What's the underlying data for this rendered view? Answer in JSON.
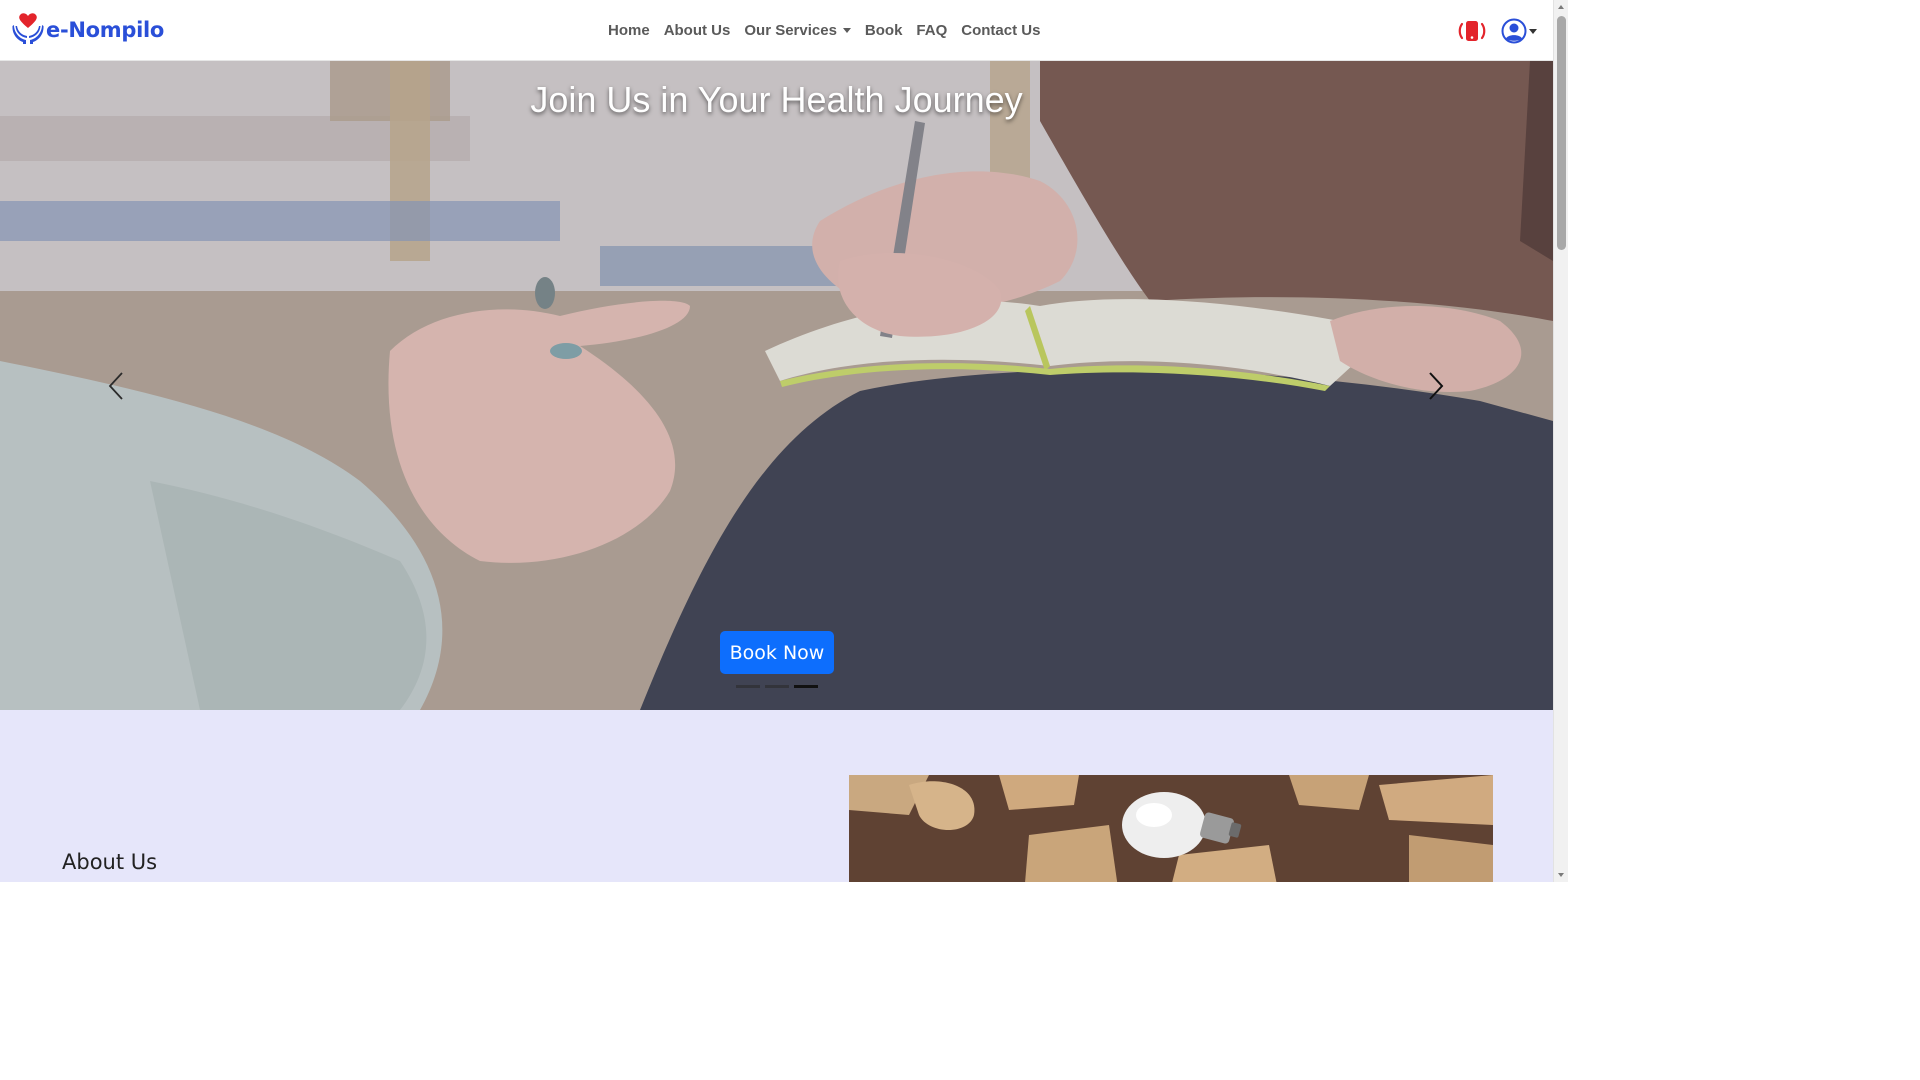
{
  "brand": {
    "name": "e-Nompilo",
    "logo_icon": "heart-hands-icon"
  },
  "nav": {
    "items": [
      {
        "label": "Home"
      },
      {
        "label": "About Us"
      },
      {
        "label": "Our Services",
        "dropdown": true
      },
      {
        "label": "Book"
      },
      {
        "label": "FAQ"
      },
      {
        "label": "Contact Us"
      }
    ]
  },
  "header_actions": {
    "emergency_icon": "emergency-phone-icon",
    "user_icon": "user-circle-icon"
  },
  "hero": {
    "title": "Join Us in Your Health Journey",
    "cta_label": "Book Now",
    "slide_count": 3,
    "active_slide": 3
  },
  "about": {
    "heading": "About Us"
  },
  "colors": {
    "brand_blue": "#2a4fd8",
    "cta_blue": "#0d6efd",
    "emergency_red": "#e3242b",
    "about_bg": "#e6e6fa"
  }
}
